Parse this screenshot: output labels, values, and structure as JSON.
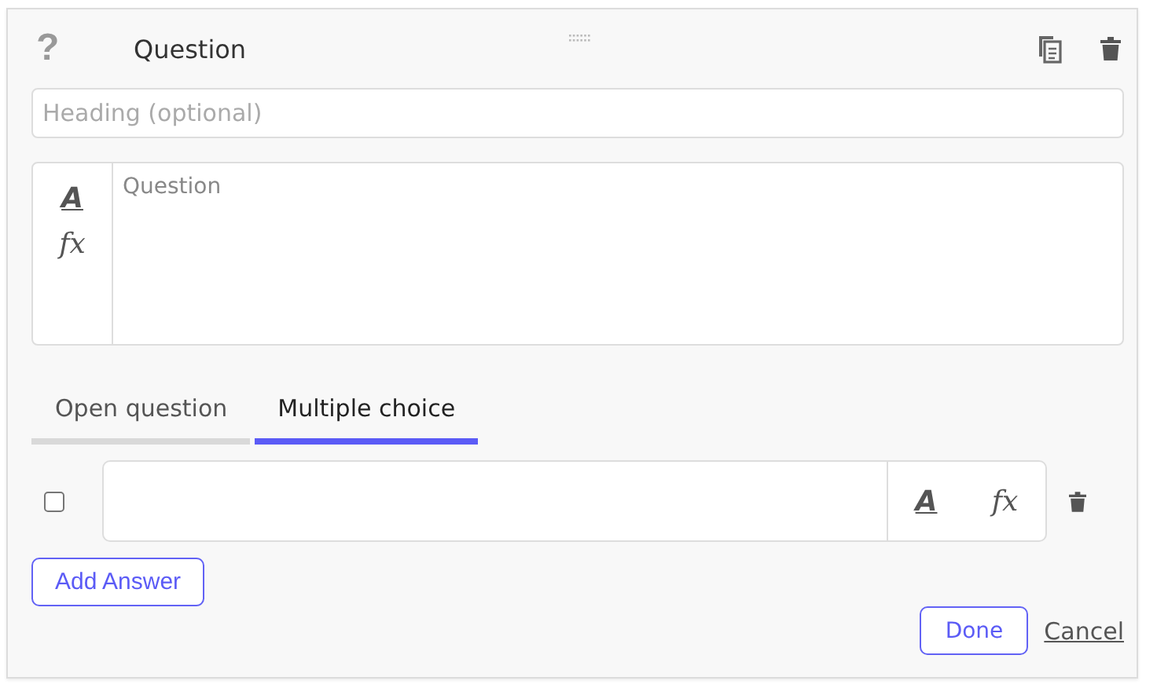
{
  "help_icon_text": "?",
  "title": "Question",
  "heading": {
    "placeholder": "Heading (optional)"
  },
  "question": {
    "format_button": "A",
    "formula_button": "fx",
    "placeholder": "Question"
  },
  "tabs": [
    {
      "label": "Open question",
      "selected": false
    },
    {
      "label": "Multiple choice",
      "selected": true
    }
  ],
  "answers": [
    {
      "checked": false,
      "format_button": "A",
      "formula_button": "fx"
    }
  ],
  "add_answer": "Add Answer",
  "buttons": {
    "done": "Done",
    "cancel": "Cancel"
  }
}
